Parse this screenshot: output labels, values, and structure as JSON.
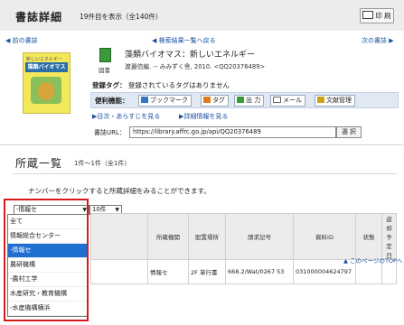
{
  "header": {
    "title": "書誌詳細",
    "count": "19件目を表示（全140件）",
    "print_label": "印 刷"
  },
  "nav": {
    "prev": "前の書誌",
    "back": "検索結果一覧へ戻る",
    "next": "次の書誌"
  },
  "book": {
    "cover_top": "新しいエネルギー",
    "cover_title": "藻類バイオマス",
    "icon_label": "図書",
    "title": "藻類バイオマス：新しいエネルギー",
    "meta": "渡邉信編. -- みみずく舎, 2010. <QQ20376489>"
  },
  "tags": {
    "label": "登録タグ：",
    "value": "登録されているタグはありません"
  },
  "tools": {
    "label": "便利機能：",
    "buttons": [
      "ブックマーク",
      "タグ",
      "出 力",
      "メール",
      "文献管理"
    ]
  },
  "links": {
    "toc": "目次・あらすじを見る",
    "detail": "詳細情報を見る"
  },
  "url": {
    "label": "書誌URL：",
    "value": "https://library.affrc.go.jp/api/QQ20376489",
    "select_label": "選 択"
  },
  "holdings": {
    "title": "所蔵一覧",
    "range": "1件～1件（全1件）",
    "instruction": "ナンバーをクリックすると所蔵詳細をみることができます。",
    "filter_selected": "-情報セ",
    "per_page": "10件",
    "columns": [
      "所蔵機関",
      "配置場所",
      "請求記号",
      "資料ID",
      "状態",
      "返却予定日"
    ],
    "row": {
      "org": "情報セ",
      "location": "2F 単行書",
      "call_number": "668.2/Wat/0267 53",
      "item_id": "031000004624797",
      "status": "",
      "due": ""
    },
    "top_link": "このページのTOPへ"
  },
  "dropdown": {
    "options": [
      "全て",
      "情報総合センター",
      "-情報セ",
      "農研機構",
      "-農村工学",
      "水産研究・教育機構",
      "-水産機構横浜"
    ],
    "selected_index": 2
  },
  "colors": {
    "link": "#1a4fa0",
    "highlight_border": "#d81a1a",
    "selected_option": "#1e6fd0",
    "toolbar_bg": "#dfe8f3"
  }
}
